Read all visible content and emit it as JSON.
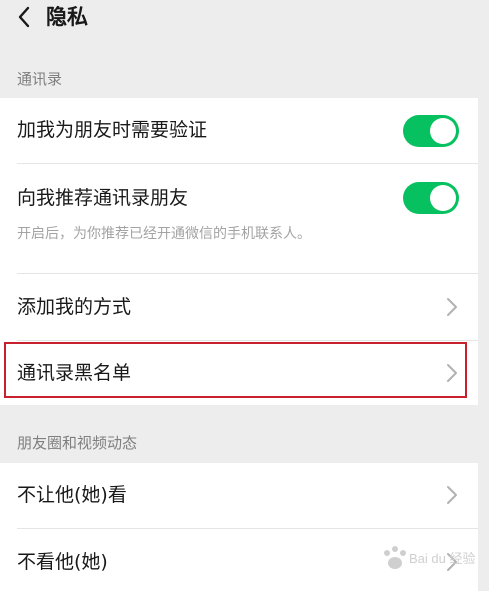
{
  "nav": {
    "title": "隐私"
  },
  "sections": {
    "contacts": {
      "header": "通讯录",
      "rows": {
        "verify": {
          "label": "加我为朋友时需要验证",
          "toggle_on": true
        },
        "recommend": {
          "label": "向我推荐通讯录朋友",
          "toggle_on": true,
          "description": "开启后，为你推荐已经开通微信的手机联系人。"
        },
        "add_methods": {
          "label": "添加我的方式"
        },
        "blacklist": {
          "label": "通讯录黑名单"
        }
      }
    },
    "moments": {
      "header": "朋友圈和视频动态",
      "rows": {
        "hide_from": {
          "label": "不让他(她)看"
        },
        "dont_see": {
          "label": "不看他(她)"
        }
      }
    }
  },
  "watermark": {
    "text": "Bai du 经验"
  },
  "colors": {
    "background": "#ededed",
    "toggle_on": "#07c160",
    "highlight_border": "#c8202c",
    "secondary_text": "#a3a3a3"
  }
}
